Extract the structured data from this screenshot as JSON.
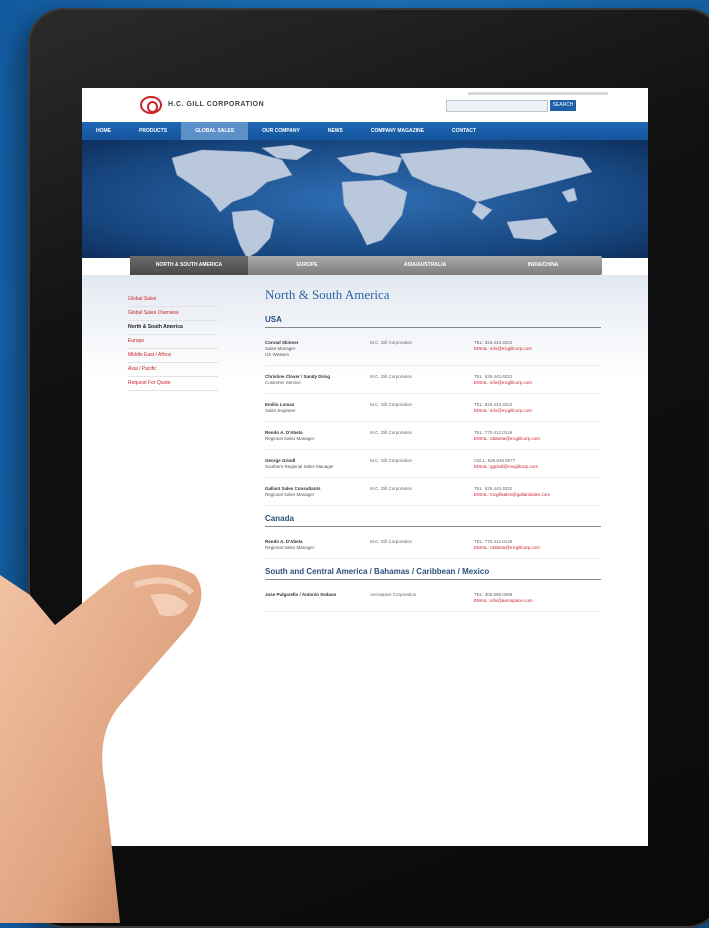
{
  "header": {
    "brand": "H.C. GILL CORPORATION",
    "search_button": "SEARCH"
  },
  "nav": [
    "HOME",
    "PRODUCTS",
    "GLOBAL SALES",
    "OUR COMPANY",
    "NEWS",
    "COMPANY MAGAZINE",
    "CONTACT"
  ],
  "region_tabs": [
    "NORTH & SOUTH AMERICA",
    "EUROPE",
    "ASIA/AUSTRALIA",
    "INDIA/CHINA"
  ],
  "sidebar": [
    "Global Sales",
    "Global Sales Overview",
    "North & South America",
    "Europe",
    "Middle East / Africa",
    "Asia / Pacific",
    "Request For Quote"
  ],
  "main": {
    "title": "North & South America",
    "sections": [
      {
        "heading": "USA",
        "entries": [
          {
            "name": "Conrad Skinner",
            "role": "Sales Manager",
            "region": "US Western",
            "addr": "M.C. Gill Corporation",
            "tel": "TEL: 626.443.4022",
            "email": "EMAIL: info@mcgillcorp.com"
          },
          {
            "name": "Christine Clover / Sandy Dring",
            "role": "Customer Service",
            "region": "",
            "addr": "M.C. Gill Corporation",
            "tel": "TEL: 626.443.4022",
            "email": "EMAIL: info@mcgillcorp.com"
          },
          {
            "name": "Emilio Lomas",
            "role": "Sales Engineer",
            "region": "",
            "addr": "M.C. Gill Corporation",
            "tel": "TEL: 626.443.4022",
            "email": "EMAIL: info@mcgillcorp.com"
          },
          {
            "name": "Rendo A. D'Abeta",
            "role": "Regional Sales Manager",
            "region": "",
            "addr": "M.C. Gill Corporation",
            "tel": "TEL: 770.412.0146",
            "email": "EMAIL: rdabeta@mcgillcorp.com"
          },
          {
            "name": "George Grindl",
            "role": "Southern Regional Sales Manager",
            "region": "",
            "addr": "M.C. Gill Corporation",
            "tel": "CELL: 626.616.9077",
            "email": "EMAIL: ggrindl@mcgillcorp.com"
          },
          {
            "name": "Gallant Sales Consultants",
            "role": "Regional Sales Manager",
            "region": "",
            "addr": "M.C. Gill Corporation",
            "tel": "TEL: 626.443.4022",
            "email": "EMAIL: mcgillsales@gallantsales.com"
          }
        ]
      },
      {
        "heading": "Canada",
        "entries": [
          {
            "name": "Rendo A. D'Abeta",
            "role": "Regional Sales Manager",
            "region": "",
            "addr": "M.C. Gill Corporation",
            "tel": "TEL: 770.412.0146",
            "email": "EMAIL: rdabeta@mcgillcorp.com"
          }
        ]
      },
      {
        "heading": "South and Central America / Bahamas / Caribbean / Mexico",
        "entries": [
          {
            "name": "Jose Pulgarello / Antonio Sedano",
            "role": "",
            "region": "",
            "addr": "Aerospace Corporation",
            "tel": "TEL: 305.599.0068",
            "email": "EMAIL: info@aerospace.com"
          }
        ]
      }
    ]
  },
  "colors": {
    "nav_blue": "#1f67b5",
    "accent_red": "#c8232b",
    "heading_blue": "#2c63a4"
  }
}
